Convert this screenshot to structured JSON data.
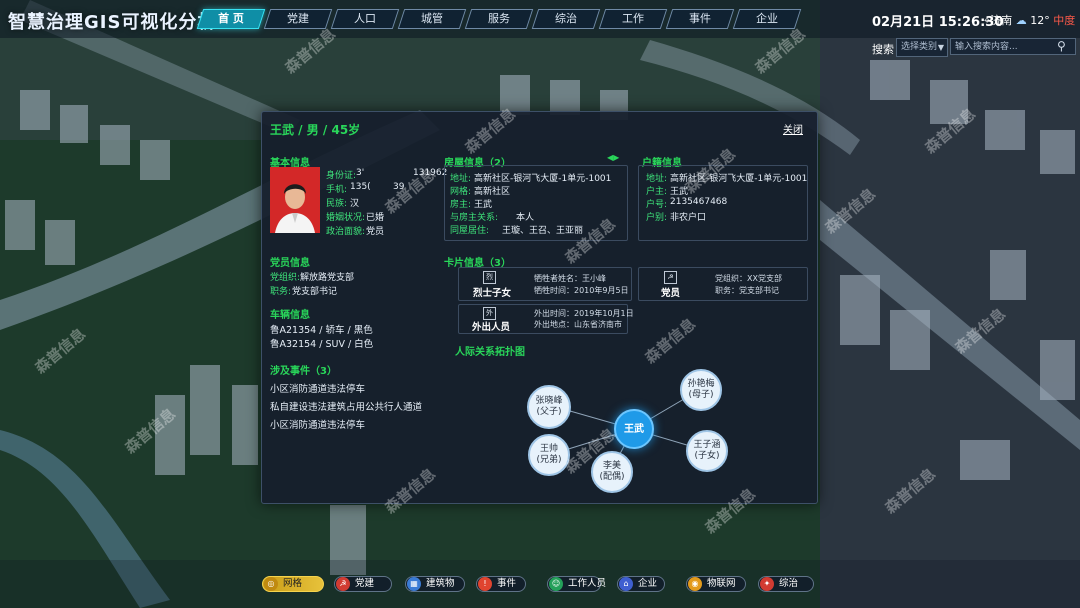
{
  "app_title": "智慧治理GIS可视化分析",
  "nav_tabs": [
    "首 页",
    "党建",
    "人口",
    "城管",
    "服务",
    "综治",
    "工作",
    "事件",
    "企业"
  ],
  "active_tab_index": 0,
  "datetime": "02月21日 15:26:30",
  "weather": {
    "city": "济南",
    "temperature": "12°",
    "aqi": "中度",
    "icon": "cloud-icon"
  },
  "search": {
    "label": "搜索",
    "category_placeholder": "选择类别",
    "input_placeholder": "输入搜索内容..."
  },
  "panel": {
    "title": "王武 / 男 / 45岁",
    "close_label": "关闭",
    "basic": {
      "title": "基本信息",
      "fields": [
        {
          "label": "身份证:",
          "value": "3'"
        },
        {
          "label": "手机:",
          "value": "135("
        },
        {
          "label": "民族:",
          "value": "汉"
        },
        {
          "label": "婚姻状况:",
          "value": "已婚"
        },
        {
          "label": "政治面貌:",
          "value": "党员"
        }
      ],
      "id_tail": "131962",
      "phone_tail": "39"
    },
    "house": {
      "title": "房屋信息（2）",
      "fields": [
        {
          "label": "地址:",
          "value": "高新社区-银河飞大厦-1单元-1001"
        },
        {
          "label": "网格:",
          "value": "高新社区"
        },
        {
          "label": "房主:",
          "value": "王武"
        },
        {
          "label": "与房主关系:",
          "value": "本人"
        },
        {
          "label": "同屋居住:",
          "value": "王璇、王召、王亚丽"
        }
      ]
    },
    "household": {
      "title": "户籍信息",
      "fields": [
        {
          "label": "地址:",
          "value": "高新社区-银河飞大厦-1单元-1001"
        },
        {
          "label": "户主:",
          "value": "王武"
        },
        {
          "label": "户号:",
          "value": "2135467468"
        },
        {
          "label": "户别:",
          "value": "非农户口"
        }
      ]
    },
    "party": {
      "title": "党员信息",
      "fields": [
        {
          "label": "党组织:",
          "value": "解放路党支部"
        },
        {
          "label": "职务:",
          "value": "党支部书记"
        }
      ]
    },
    "vehicles": {
      "title": "车辆信息",
      "items": [
        "鲁A21354 / 轿车 / 黑色",
        "鲁A32154 / SUV / 白色"
      ]
    },
    "events": {
      "title": "涉及事件（3）",
      "items": [
        "小区消防通道违法停车",
        "私自建设违法建筑占用公共行人通道",
        "小区消防通道违法停车"
      ]
    },
    "cards": {
      "title": "卡片信息（3）",
      "items": [
        {
          "name": "烈士子女",
          "icon": "烈",
          "lines": [
            "牺牲者姓名：王小峰",
            "牺牲时间：2010年9月5日"
          ]
        },
        {
          "name": "党员",
          "icon": "☭",
          "lines": [
            "党组织：XX党支部",
            "职务：党支部书记"
          ]
        },
        {
          "name": "外出人员",
          "icon": "外",
          "lines": [
            "外出时间：2019年10月1日",
            "外出地点：山东省济南市"
          ]
        }
      ]
    },
    "relations": {
      "title": "人际关系拓扑图",
      "center": "王武",
      "nodes": [
        {
          "name": "张晓峰",
          "role": "(父子)"
        },
        {
          "name": "孙艳梅",
          "role": "(母子)"
        },
        {
          "name": "王帅",
          "role": "(兄弟)"
        },
        {
          "name": "李美",
          "role": "(配偶)"
        },
        {
          "name": "王子涵",
          "role": "(子女)"
        }
      ]
    }
  },
  "dock": [
    {
      "label": "网格",
      "icon": "grid-icon",
      "color": "#d9a81c"
    },
    {
      "label": "党建",
      "icon": "party-icon",
      "color": "#d23b32"
    },
    {
      "label": "建筑物",
      "icon": "building-icon",
      "color": "#3a7bd5"
    },
    {
      "label": "事件",
      "icon": "alert-icon",
      "color": "#e0442f"
    },
    {
      "label": "工作人员",
      "icon": "staff-icon",
      "color": "#24a05a"
    },
    {
      "label": "企业",
      "icon": "enterprise-icon",
      "color": "#3f5fd0"
    },
    {
      "label": "物联网",
      "icon": "iot-icon",
      "color": "#e39a1c"
    },
    {
      "label": "综治",
      "icon": "governance-icon",
      "color": "#d23b32"
    }
  ],
  "watermark": "森普信息"
}
